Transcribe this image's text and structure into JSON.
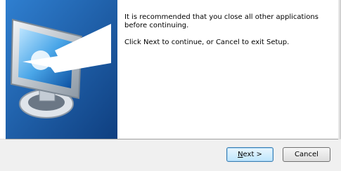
{
  "content": {
    "paragraph_1": "It is recommended that you close all other applications before continuing.",
    "paragraph_2": "Click Next to continue, or Cancel to exit Setup."
  },
  "buttons": {
    "next_accel": "N",
    "next_rest": "ext >",
    "cancel_label": "Cancel"
  },
  "colors": {
    "banner_blue": "#1d5fa8",
    "footer_bg": "#f0f0f0"
  },
  "icons": {
    "banner": "computer-monitor-icon"
  }
}
